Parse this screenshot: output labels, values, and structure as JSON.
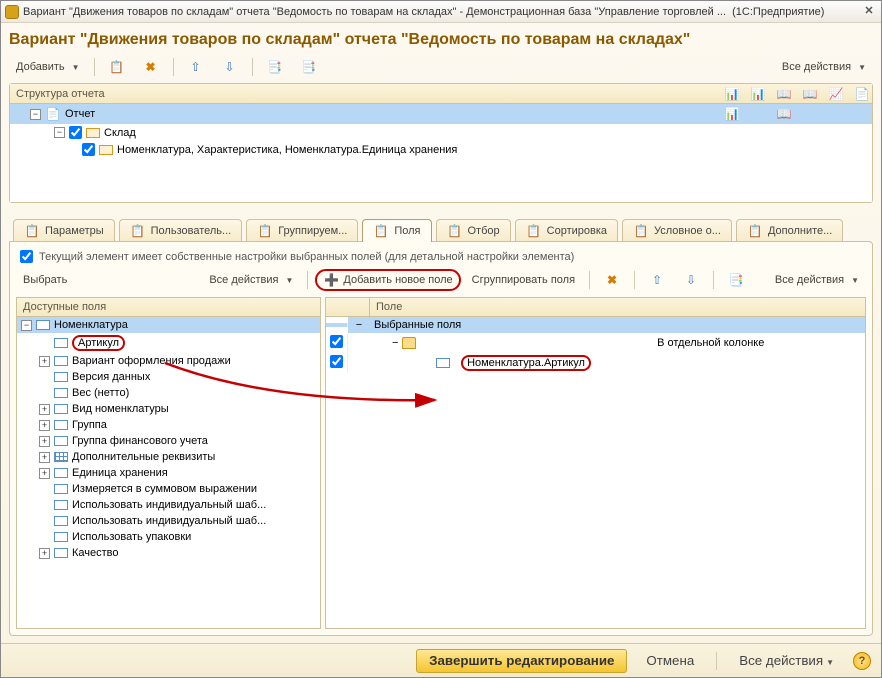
{
  "window": {
    "title_left": "Вариант \"Движения товаров по складам\" отчета \"Ведомость по товарам на складах\" - Демонстрационная база \"Управление торговлей ...",
    "title_right": "(1С:Предприятие)"
  },
  "page_title": "Вариант \"Движения товаров по складам\" отчета \"Ведомость по товарам на складах\"",
  "main_toolbar": {
    "add": "Добавить",
    "all_actions": "Все действия"
  },
  "structure": {
    "header": "Структура отчета",
    "root": "Отчет",
    "level1": "Склад",
    "level2": "Номенклатура, Характеристика, Номенклатура.Единица хранения"
  },
  "tabs": [
    "Параметры",
    "Пользователь...",
    "Группируем...",
    "Поля",
    "Отбор",
    "Сортировка",
    "Условное о...",
    "Дополните..."
  ],
  "hint": "Текущий элемент имеет собственные настройки выбранных полей (для детальной настройки элемента)",
  "tb2": {
    "select": "Выбрать",
    "all_actions": "Все действия",
    "add_new_field": "Добавить новое поле",
    "group_fields": "Сгруппировать поля",
    "all_actions_r": "Все действия"
  },
  "left_header": "Доступные поля",
  "right_header": "Поле",
  "left_tree": {
    "root": "Номенклатура",
    "items": [
      "Артикул",
      "Вариант оформления продажи",
      "Версия данных",
      "Вес (нетто)",
      "Вид номенклатуры",
      "Группа",
      "Группа финансового учета",
      "Дополнительные реквизиты",
      "Единица хранения",
      "Измеряется в суммовом выражении",
      "Использовать индивидуальный шаб...",
      "Использовать индивидуальный шаб...",
      "Использовать упаковки",
      "Качество"
    ]
  },
  "right_tree": {
    "selected_fields": "Выбранные поля",
    "sep_column": "В отдельной колонке",
    "added_field": "Номенклатура.Артикул"
  },
  "footer": {
    "finish": "Завершить редактирование",
    "cancel": "Отмена",
    "all_actions": "Все действия"
  }
}
